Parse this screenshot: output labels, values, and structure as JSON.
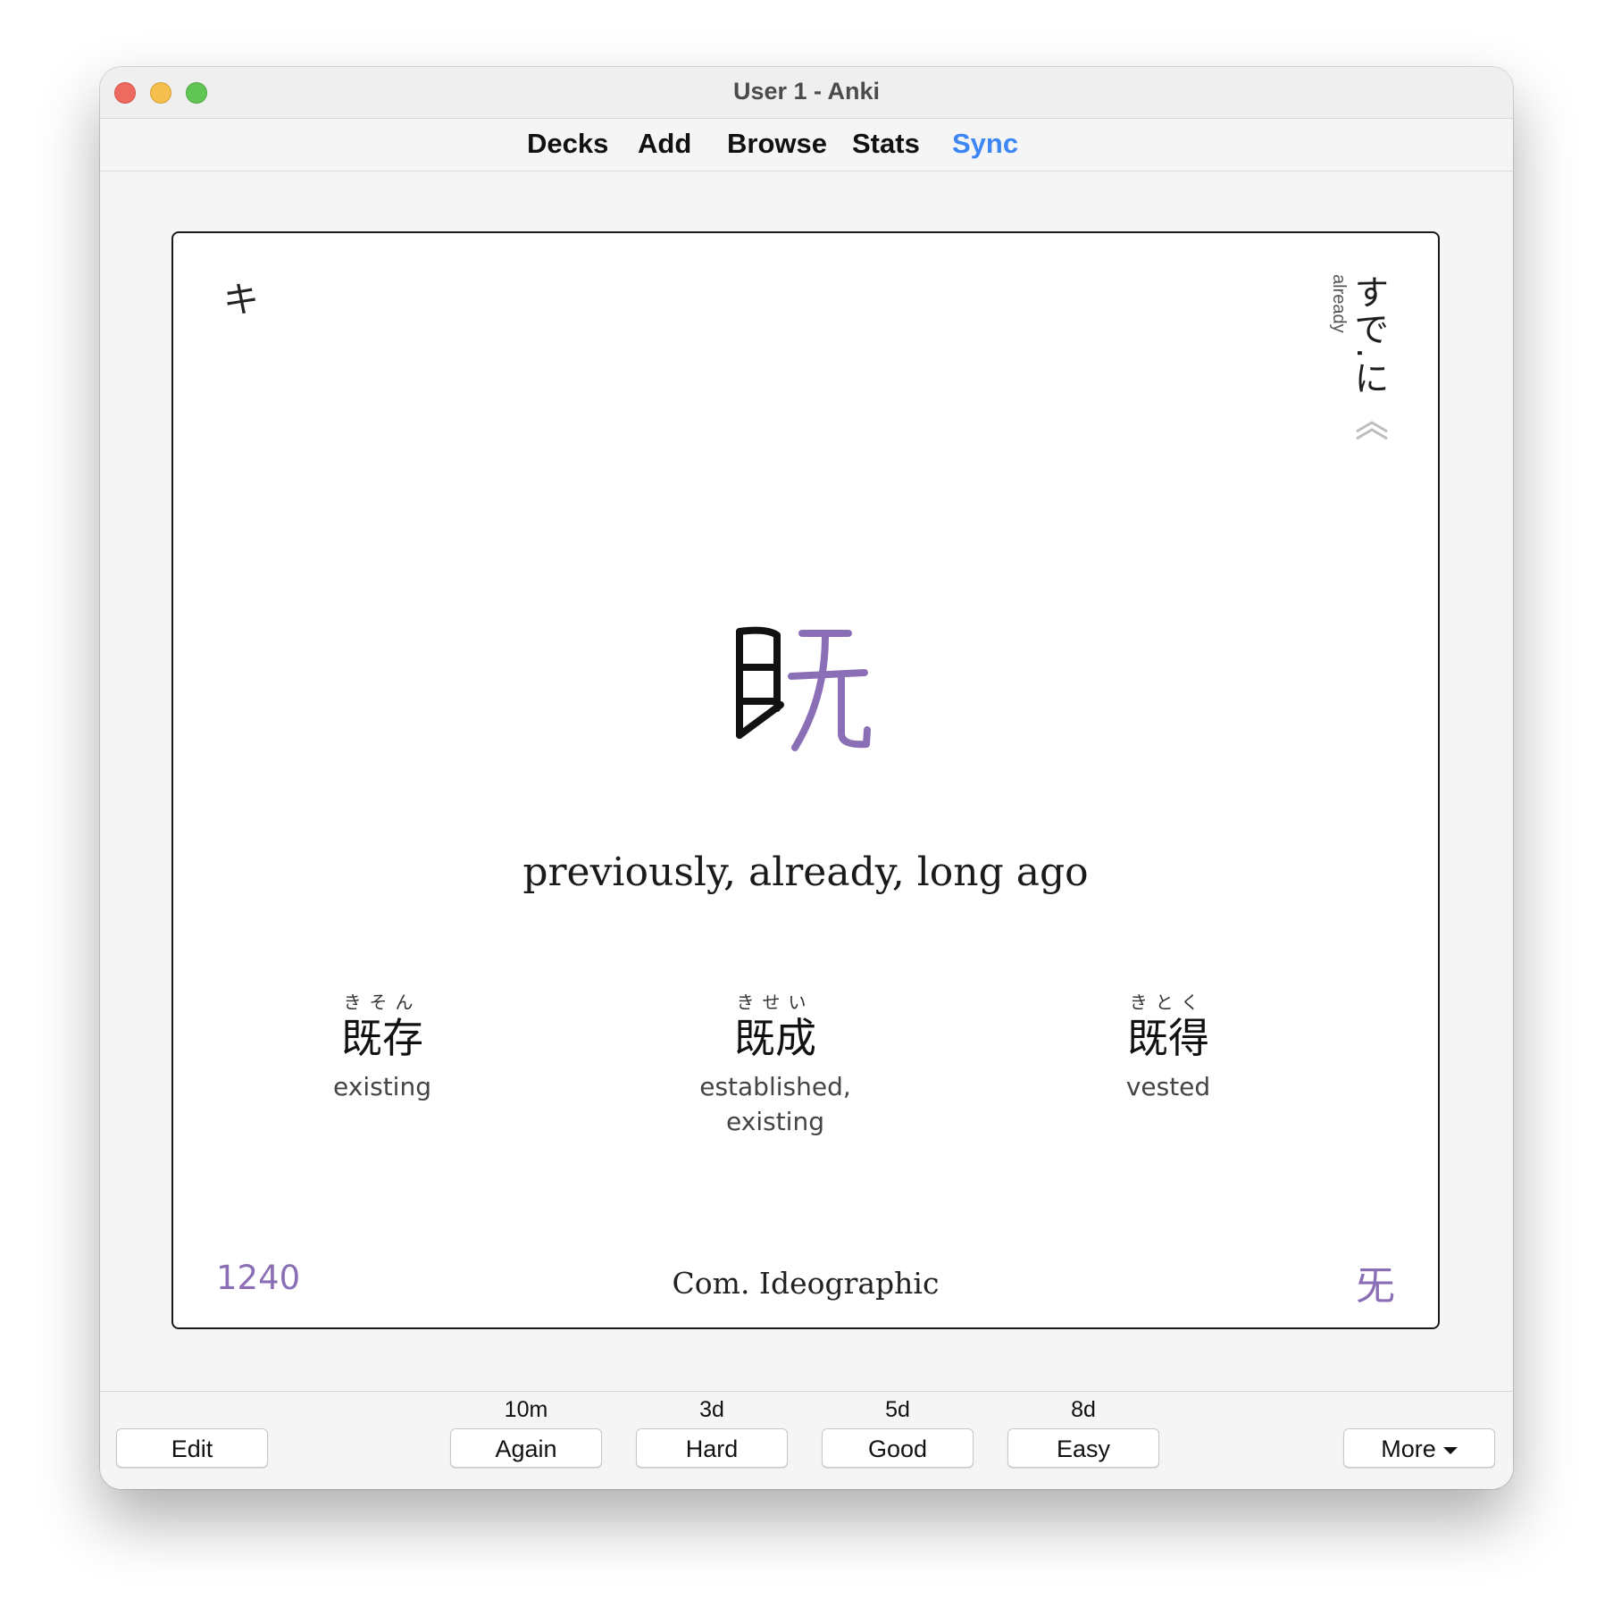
{
  "window": {
    "title": "User 1 - Anki"
  },
  "toolbar": {
    "decks": "Decks",
    "add": "Add",
    "browse": "Browse",
    "stats": "Stats",
    "sync": "Sync"
  },
  "card": {
    "onyomi": "キ",
    "kunyomi": "すで.に",
    "kunyomi_meaning": "already",
    "kanji": "既",
    "meaning": "previously, already, long ago",
    "vocab": [
      {
        "furigana": "きそん",
        "word": "既存",
        "gloss": "existing"
      },
      {
        "furigana": "きせい",
        "word": "既成",
        "gloss": "established,\nexisting"
      },
      {
        "furigana": "きとく",
        "word": "既得",
        "gloss": "vested"
      }
    ],
    "frequency": "1240",
    "category": "Com. Ideographic",
    "component": "旡"
  },
  "answer_buttons": [
    {
      "interval": "10m",
      "label": "Again"
    },
    {
      "interval": "3d",
      "label": "Hard"
    },
    {
      "interval": "5d",
      "label": "Good"
    },
    {
      "interval": "8d",
      "label": "Easy"
    }
  ],
  "bottombar": {
    "edit": "Edit",
    "more": "More"
  },
  "colors": {
    "accent_purple": "#8b6fb6",
    "sync_blue": "#3d86f5"
  }
}
